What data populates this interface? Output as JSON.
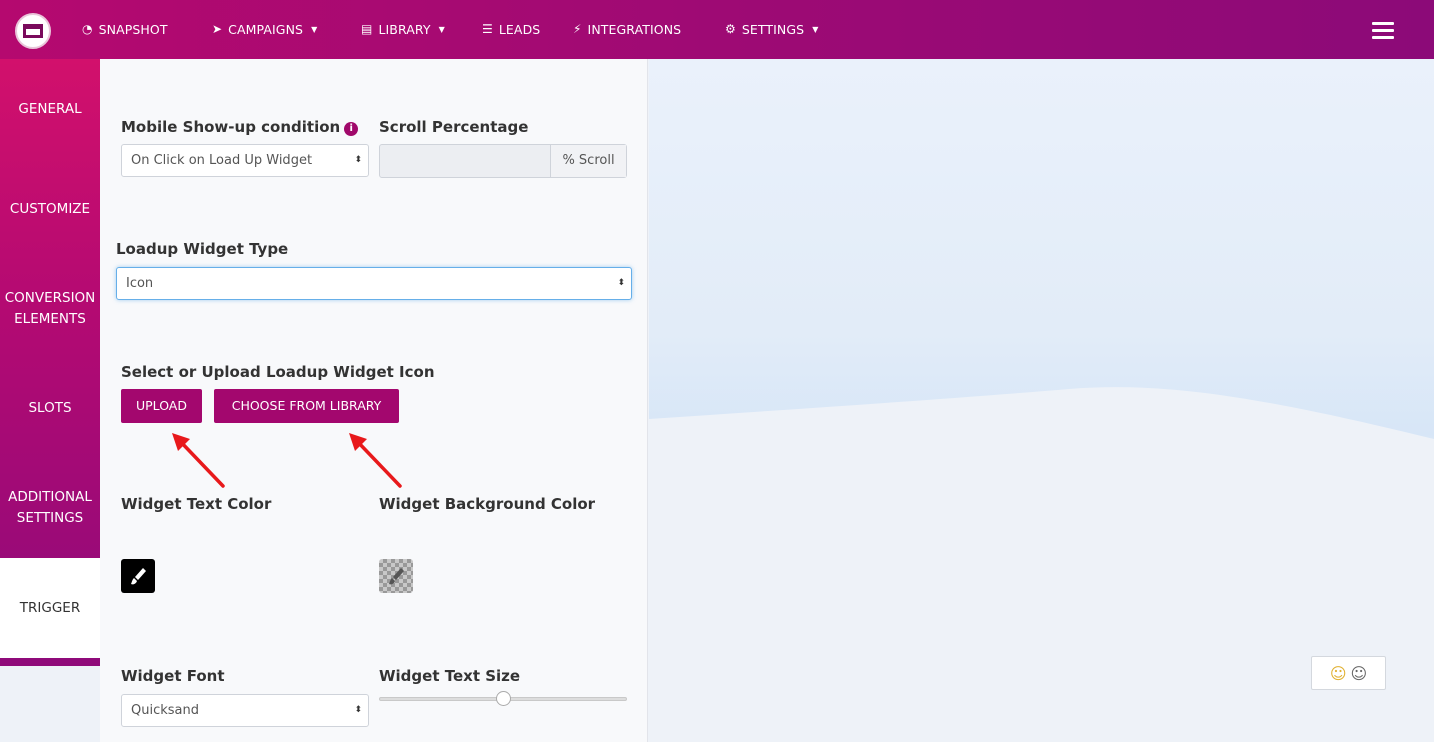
{
  "nav": {
    "items": [
      {
        "icon": "dashboard-icon",
        "label": "SNAPSHOT"
      },
      {
        "icon": "paper-plane-icon",
        "label": "CAMPAIGNS",
        "dropdown": true
      },
      {
        "icon": "book-icon",
        "label": "LIBRARY",
        "dropdown": true
      },
      {
        "icon": "list-icon",
        "label": "LEADS"
      },
      {
        "icon": "plug-icon",
        "label": "INTEGRATIONS"
      },
      {
        "icon": "gears-icon",
        "label": "SETTINGS",
        "dropdown": true
      }
    ]
  },
  "sidebar": {
    "items": [
      {
        "label": "GENERAL"
      },
      {
        "label": "CUSTOMIZE"
      },
      {
        "label": "CONVERSION ELEMENTS"
      },
      {
        "label": "SLOTS"
      },
      {
        "label": "ADDITIONAL SETTINGS"
      },
      {
        "label": "TRIGGER",
        "active": true
      }
    ]
  },
  "form": {
    "mobile_condition_label": "Mobile Show-up condition",
    "mobile_condition_value": "On Click on Load Up Widget",
    "scroll_label": "Scroll Percentage",
    "scroll_value": "",
    "scroll_addon": "% Scroll",
    "widget_type_label": "Loadup Widget Type",
    "widget_type_value": "Icon",
    "icon_label": "Select or Upload Loadup Widget Icon",
    "upload_button": "UPLOAD",
    "library_button": "CHOOSE FROM LIBRARY",
    "text_color_label": "Widget Text Color",
    "bg_color_label": "Widget Background Color",
    "text_color": "#000000",
    "bg_color": "transparent",
    "font_label": "Widget Font",
    "font_value": "Quicksand",
    "text_size_label": "Widget Text Size",
    "text_size_level": 0.5
  },
  "colors": {
    "accent": "#a3076e",
    "nav_start": "#b5096f",
    "nav_end": "#8c0a78",
    "annotation_arrow": "#e8191b"
  }
}
